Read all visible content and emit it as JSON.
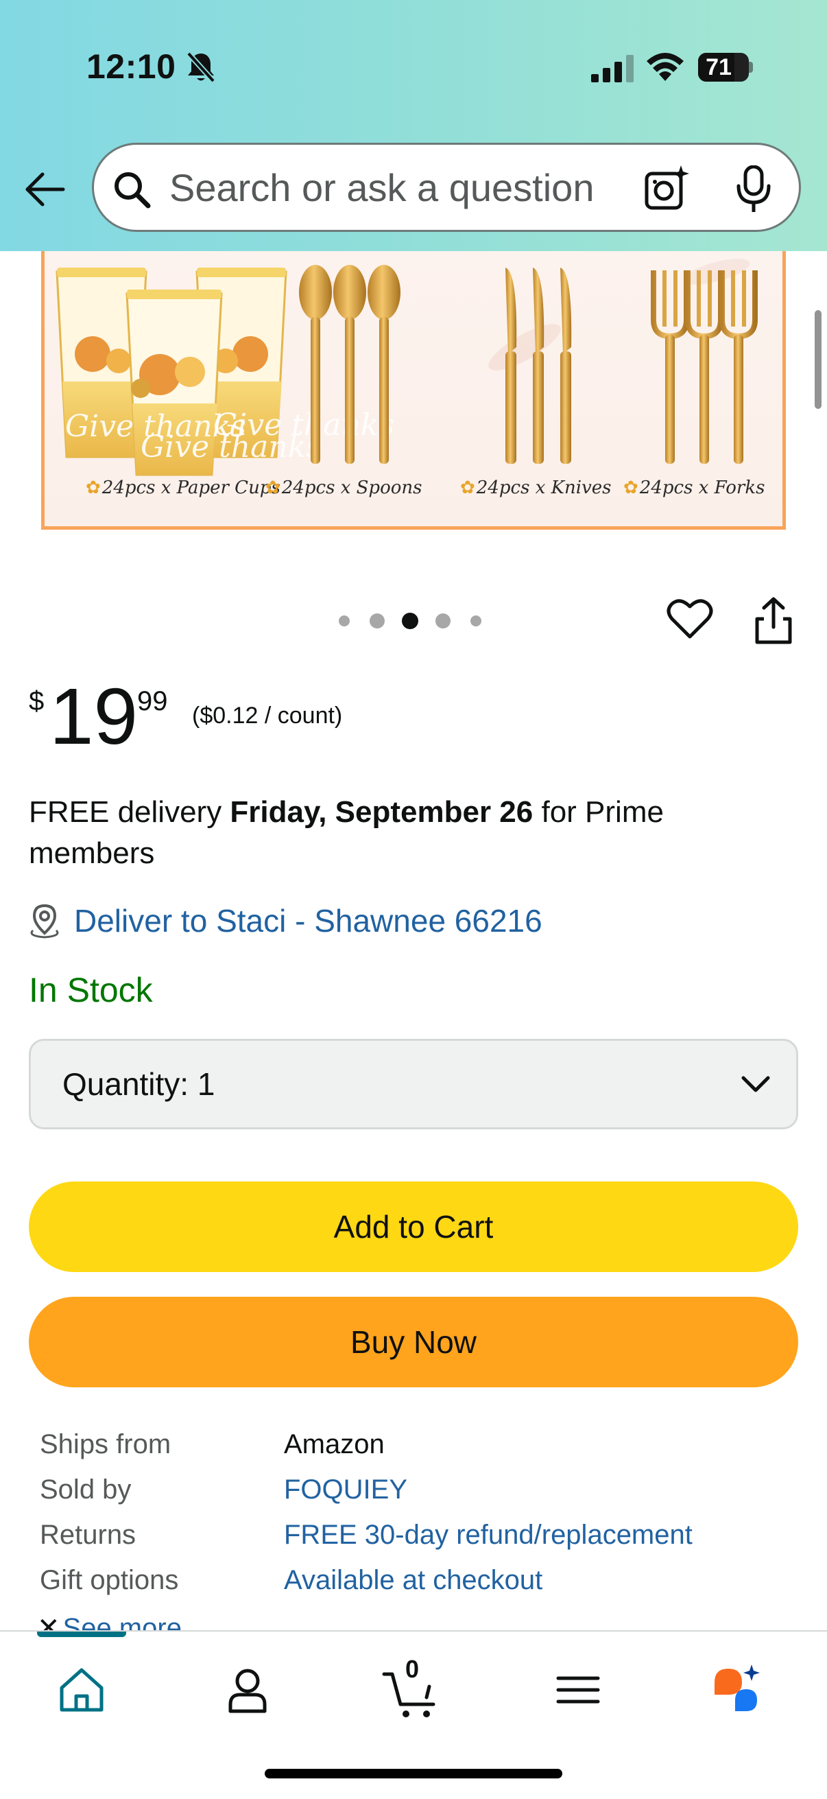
{
  "status_bar": {
    "time": "12:10",
    "battery_level": "71",
    "battery_fraction": 0.71
  },
  "search": {
    "placeholder": "Search or ask a question"
  },
  "product_image": {
    "captions": [
      "24pcs x Paper Cups",
      "24pcs x Spoons",
      "24pcs x Knives",
      "24pcs x Forks"
    ],
    "cup_text": "Give thanks",
    "image_index": 3,
    "image_count": 5
  },
  "price": {
    "symbol": "$",
    "whole": "19",
    "fraction": "99",
    "unit_price": "($0.12 / count)"
  },
  "delivery": {
    "prefix": "FREE delivery",
    "date": "Friday, September 26",
    "suffix": "for Prime members",
    "location": "Deliver to Staci - Shawnee 66216",
    "stock": "In Stock"
  },
  "quantity": {
    "label": "Quantity:",
    "value": "1"
  },
  "buttons": {
    "add_to_cart": "Add to Cart",
    "buy_now": "Buy Now"
  },
  "details": {
    "rows": [
      {
        "key": "Ships from",
        "value": "Amazon"
      },
      {
        "key": "Sold by",
        "value": "FOQUIEY"
      },
      {
        "key": "Returns",
        "value": "FREE 30-day refund/replacement"
      },
      {
        "key": "Gift options",
        "value": "Available at checkout"
      }
    ],
    "see_more": "See more"
  },
  "bottom_nav": {
    "cart_count": "0",
    "items": [
      "home-icon",
      "account-icon",
      "cart-icon",
      "menu-icon",
      "rufus-icon"
    ]
  },
  "colors": {
    "accent_teal": "#007185",
    "link_blue": "#2162a1",
    "in_stock_green": "#007600",
    "add_to_cart_yellow": "#ffd814",
    "buy_now_orange": "#ffa41c"
  }
}
